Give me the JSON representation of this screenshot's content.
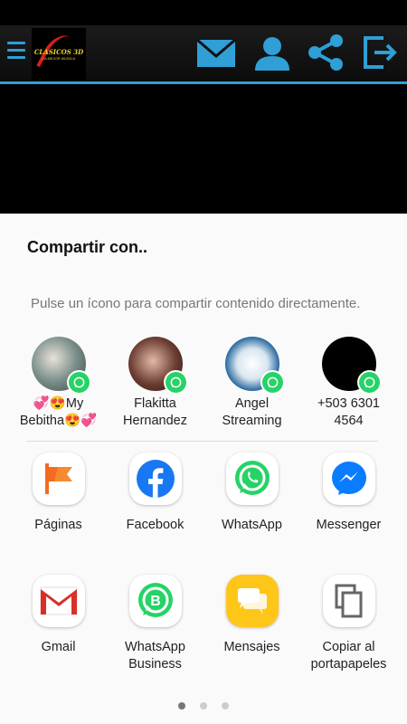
{
  "app": {
    "logo_text": "CLASICOS 3D",
    "logo_subtext": "LA MEJOR MUSICA",
    "accent": "#2f9fd6",
    "icons": [
      "menu-icon",
      "mail-icon",
      "person-icon",
      "share-icon",
      "exit-icon"
    ]
  },
  "share_sheet": {
    "title": "Compartir con..",
    "hint": "Pulse un ícono para compartir contenido directamente.",
    "direct_targets": [
      {
        "label_line1": "💞😍My",
        "label_line2": "Bebitha😍💞",
        "badge": "whatsapp-badge-icon"
      },
      {
        "label_line1": "Flakitta",
        "label_line2": "Hernandez",
        "badge": "whatsapp-badge-icon"
      },
      {
        "label_line1": "Angel",
        "label_line2": "Streaming",
        "badge": "whatsapp-badge-icon"
      },
      {
        "label_line1": "+503 6301",
        "label_line2": "4564",
        "badge": "whatsapp-badge-icon"
      }
    ],
    "apps_row1": [
      {
        "label": "Páginas",
        "icon": "pages-flag-icon"
      },
      {
        "label": "Facebook",
        "icon": "facebook-icon"
      },
      {
        "label": "WhatsApp",
        "icon": "whatsapp-icon"
      },
      {
        "label": "Messenger",
        "icon": "messenger-icon"
      }
    ],
    "apps_row2": [
      {
        "label_line1": "Gmail",
        "label_line2": "",
        "icon": "gmail-icon"
      },
      {
        "label_line1": "WhatsApp",
        "label_line2": "Business",
        "icon": "whatsapp-business-icon"
      },
      {
        "label_line1": "Mensajes",
        "label_line2": "",
        "icon": "messages-icon"
      },
      {
        "label_line1": "Copiar al",
        "label_line2": "portapapeles",
        "icon": "copy-icon"
      }
    ],
    "page_indicator": {
      "pages": 3,
      "current": 1
    }
  }
}
